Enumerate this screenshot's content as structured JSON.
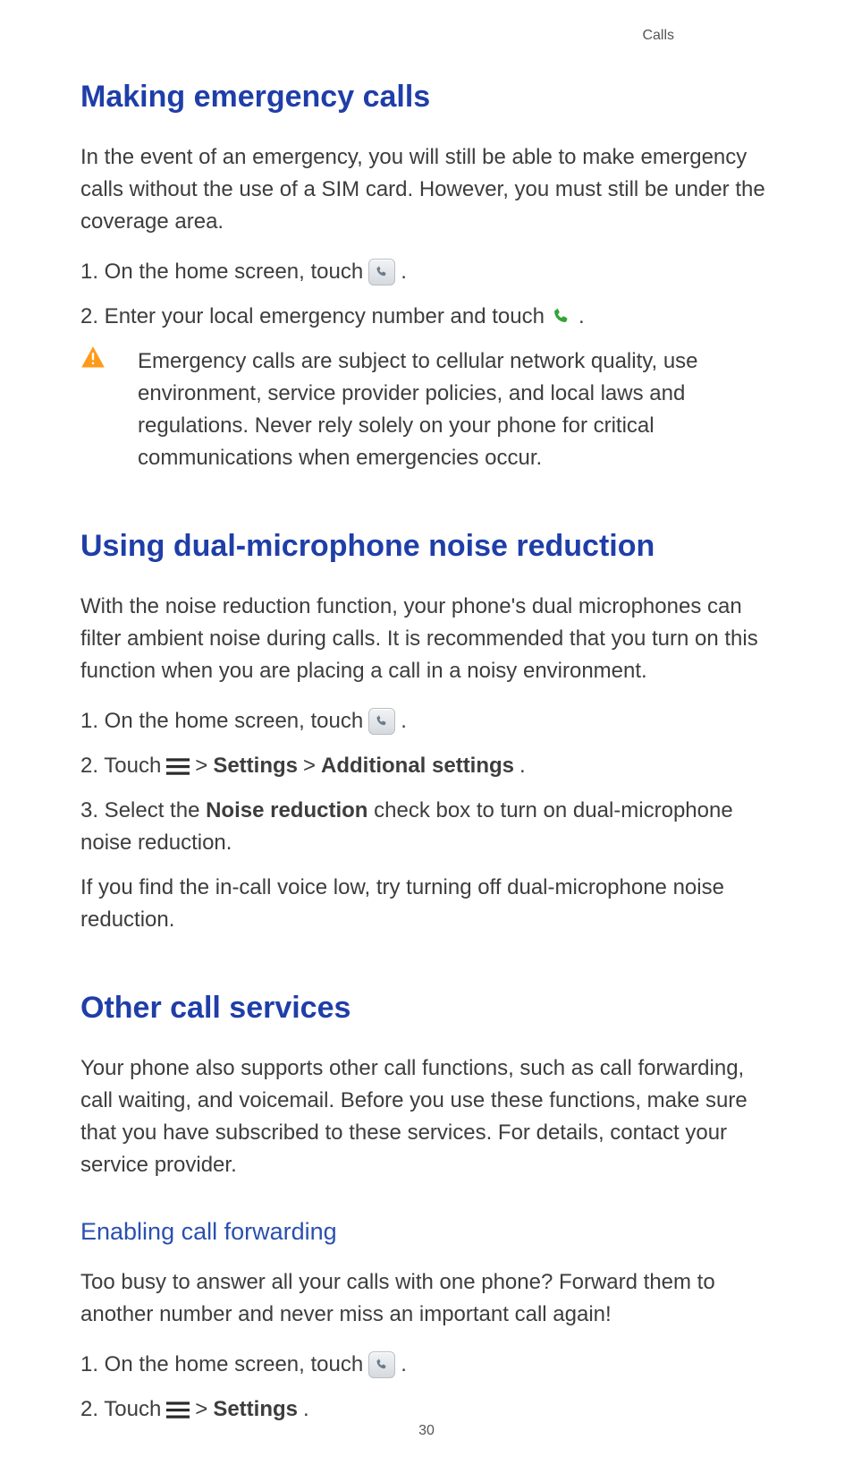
{
  "header": {
    "section": "Calls"
  },
  "page_number": "30",
  "s1": {
    "title": "Making emergency calls",
    "intro": "In the event of an emergency, you will still be able to make emergency calls without the use of a SIM card. However, you must still be under the coverage area.",
    "step1_pre": "1. On the home screen, touch ",
    "step1_post": " .",
    "step2_pre": "2. Enter your local emergency number and touch ",
    "step2_post": " .",
    "warning": "Emergency calls are subject to cellular network quality, use environment, service provider policies, and local laws and regulations. Never rely solely on your phone for critical communications when emergencies occur."
  },
  "s2": {
    "title": "Using dual-microphone noise reduction",
    "intro": "With the noise reduction function, your phone's dual microphones can filter ambient noise during calls. It is recommended that you turn on this function when you are placing a call in a noisy environment.",
    "step1_pre": "1. On the home screen, touch ",
    "step1_post": " .",
    "step2_pre": "2. Touch ",
    "step2_sep1": " > ",
    "step2_bold1": "Settings",
    "step2_sep2": " > ",
    "step2_bold2": "Additional settings",
    "step2_post": ".",
    "step3_pre": "3. Select the ",
    "step3_bold": "Noise reduction",
    "step3_post": " check box to turn on dual-microphone noise reduction.",
    "footer": "If you find the in-call voice low, try turning off dual-microphone noise reduction."
  },
  "s3": {
    "title": "Other call services",
    "intro": "Your phone also supports other call functions, such as call forwarding, call waiting, and voicemail. Before you use these functions, make sure that you have subscribed to these services. For details, contact your service provider.",
    "sub_title": "Enabling call forwarding",
    "sub_intro": "Too busy to answer all your calls with one phone? Forward them to another number and never miss an important call again!",
    "step1_pre": "1. On the home screen, touch ",
    "step1_post": " .",
    "step2_pre": "2. Touch ",
    "step2_sep": " > ",
    "step2_bold": "Settings",
    "step2_post": "."
  }
}
